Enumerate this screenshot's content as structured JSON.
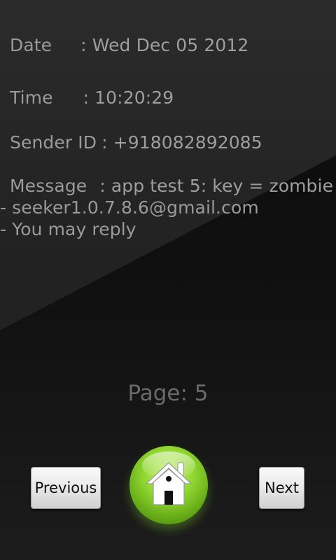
{
  "message": {
    "date_label": "Date",
    "date_value": ": Wed Dec 05 2012",
    "time_label": "Time",
    "time_value": ": 10:20:29",
    "sender_label": "Sender ID",
    "sender_value": ": +918082892085",
    "message_label": "Message",
    "message_value": ": app test 5: key = zombie",
    "message_line2": "- seeker1.0.7.8.6@gmail.com",
    "message_line3": "- You may reply"
  },
  "pager": {
    "page_text": "Page: 5"
  },
  "buttons": {
    "previous_label": "Previous",
    "next_label": "Next",
    "home_icon": "home-icon"
  },
  "colors": {
    "text": "#9a9a9a",
    "page_text": "#6a6a6a",
    "home_button": "#8fd62f"
  }
}
